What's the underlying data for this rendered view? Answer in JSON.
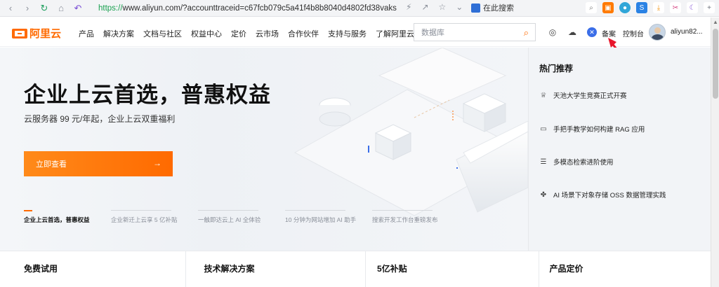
{
  "browser": {
    "url_scheme": "https://",
    "url_rest": "www.aliyun.com/?accounttraceid=c67fcb079c5a41f4b8b8040d4802fd38vaks",
    "search_label": "在此搜索"
  },
  "header": {
    "logo_text": "阿里云",
    "nav": [
      "产品",
      "解决方案",
      "文档与社区",
      "权益中心",
      "定价",
      "云市场",
      "合作伙伴",
      "支持与服务",
      "了解阿里云"
    ],
    "search_placeholder": "数据库",
    "beian": "备案",
    "console": "控制台",
    "username": "aliyun82..."
  },
  "hero": {
    "title": "企业上云首选，普惠权益",
    "subtitle": "云服务器 99 元/年起，企业上云双重福利",
    "cta": "立即查看",
    "carousel": [
      "企业上云首选，普惠权益",
      "企业新迁上云享 5 亿补贴",
      "一触即达云上 AI 全体验",
      "10 分钟为网站增加 AI 助手",
      "搜索开发工作台重磅发布"
    ]
  },
  "hot": {
    "title": "热门推荐",
    "items": [
      {
        "icon": "trophy-icon",
        "label": "天池大学生竞赛正式开赛"
      },
      {
        "icon": "monitor-icon",
        "label": "手把手教学如何构建 RAG 应用"
      },
      {
        "icon": "document-icon",
        "label": "多模态检索进阶使用"
      },
      {
        "icon": "storage-network-icon",
        "label": "AI 场景下对象存储 OSS 数据管理实践"
      }
    ]
  },
  "bottom": [
    "免费试用",
    "技术解决方案",
    "5亿补贴",
    "产品定价"
  ],
  "colors": {
    "brand": "#ff6a00",
    "annotation_arrow": "#e8162b"
  }
}
